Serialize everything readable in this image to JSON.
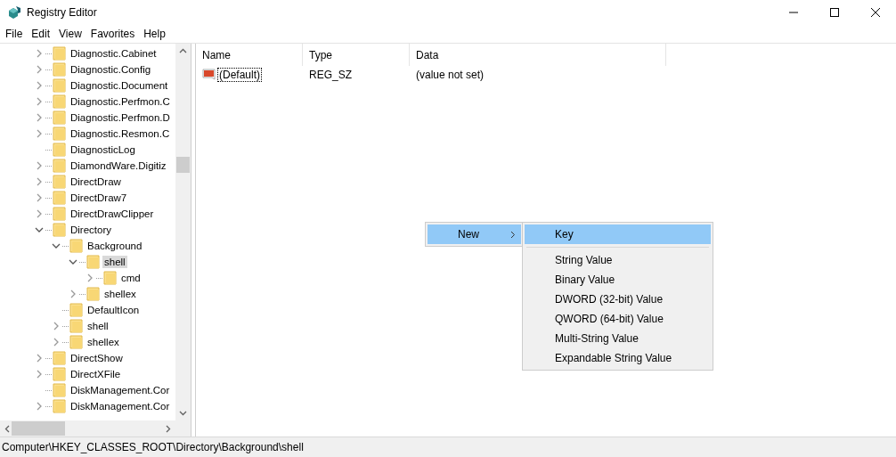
{
  "window": {
    "title": "Registry Editor"
  },
  "menu": [
    "File",
    "Edit",
    "View",
    "Favorites",
    "Help"
  ],
  "tree": [
    {
      "label": "Diagnostic.Cabinet",
      "kind": "collapsed",
      "selected": false
    },
    {
      "label": "Diagnostic.Config",
      "kind": "collapsed",
      "selected": false
    },
    {
      "label": "Diagnostic.Document",
      "kind": "collapsed",
      "selected": false
    },
    {
      "label": "Diagnostic.Perfmon.C",
      "kind": "collapsed",
      "selected": false
    },
    {
      "label": "Diagnostic.Perfmon.D",
      "kind": "collapsed",
      "selected": false
    },
    {
      "label": "Diagnostic.Resmon.C",
      "kind": "collapsed",
      "selected": false
    },
    {
      "label": "DiagnosticLog",
      "kind": "leaf",
      "selected": false
    },
    {
      "label": "DiamondWare.Digitiz",
      "kind": "collapsed",
      "selected": false
    },
    {
      "label": "DirectDraw",
      "kind": "collapsed",
      "selected": false
    },
    {
      "label": "DirectDraw7",
      "kind": "collapsed",
      "selected": false
    },
    {
      "label": "DirectDrawClipper",
      "kind": "collapsed",
      "selected": false
    },
    {
      "label": "Directory",
      "kind": "expanded",
      "selected": false,
      "children": [
        {
          "label": "Background",
          "kind": "expanded",
          "selected": false,
          "children": [
            {
              "label": "shell",
              "kind": "expanded",
              "selected": true,
              "children": [
                {
                  "label": "cmd",
                  "kind": "collapsed",
                  "selected": false
                }
              ]
            },
            {
              "label": "shellex",
              "kind": "collapsed",
              "selected": false
            }
          ]
        },
        {
          "label": "DefaultIcon",
          "kind": "leaf",
          "selected": false
        },
        {
          "label": "shell",
          "kind": "collapsed",
          "selected": false
        },
        {
          "label": "shellex",
          "kind": "collapsed",
          "selected": false
        }
      ]
    },
    {
      "label": "DirectShow",
      "kind": "collapsed",
      "selected": false
    },
    {
      "label": "DirectXFile",
      "kind": "collapsed",
      "selected": false
    },
    {
      "label": "DiskManagement.Cor",
      "kind": "leaf",
      "selected": false
    },
    {
      "label": "DiskManagement.Cor",
      "kind": "collapsed",
      "selected": false
    }
  ],
  "table": {
    "columns": [
      "Name",
      "Type",
      "Data"
    ],
    "rows": [
      {
        "name": "(Default)",
        "type": "REG_SZ",
        "data": "(value not set)",
        "focused": true
      }
    ]
  },
  "context_menu": {
    "items": [
      {
        "label": "New",
        "selected": true
      }
    ]
  },
  "submenu": {
    "items": [
      {
        "label": "Key",
        "kind": "item",
        "selected": true
      },
      {
        "kind": "separator"
      },
      {
        "label": "String Value",
        "kind": "item",
        "selected": false
      },
      {
        "label": "Binary Value",
        "kind": "item",
        "selected": false
      },
      {
        "label": "DWORD (32-bit) Value",
        "kind": "item",
        "selected": false
      },
      {
        "label": "QWORD (64-bit) Value",
        "kind": "item",
        "selected": false
      },
      {
        "label": "Multi-String Value",
        "kind": "item",
        "selected": false
      },
      {
        "label": "Expandable String Value",
        "kind": "item",
        "selected": false
      }
    ]
  },
  "status_bar": "Computer\\HKEY_CLASSES_ROOT\\Directory\\Background\\shell"
}
